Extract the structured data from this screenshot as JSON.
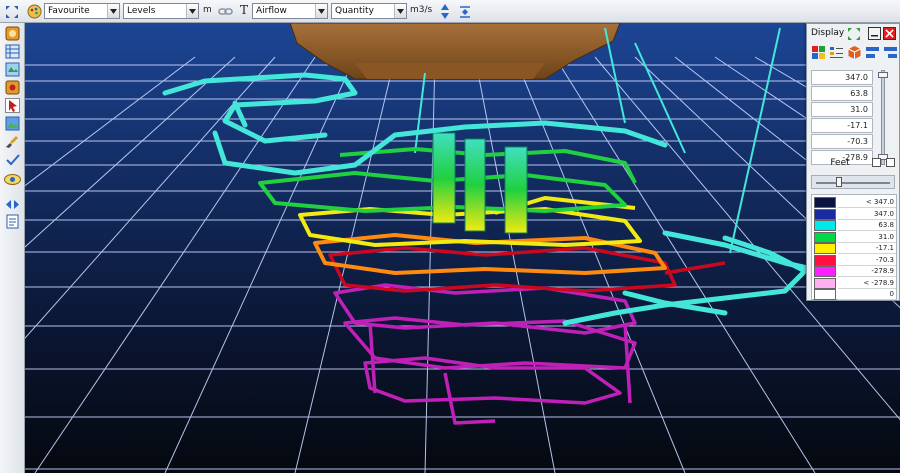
{
  "toolbar": {
    "favourite_label": "Favourite",
    "levels_label": "Levels",
    "levels_unit": "m",
    "text_tool_glyph": "T",
    "attribute_label": "Airflow",
    "measure_label": "Quantity",
    "unit_label": "m3/s"
  },
  "panel": {
    "title": "Display",
    "values": [
      "347.0",
      "63.8",
      "31.0",
      "-17.1",
      "-70.3",
      "-278.9"
    ],
    "mode_label": "Feet"
  },
  "legend": [
    {
      "color": "#0a1440",
      "label": "< 347.0"
    },
    {
      "color": "#1a2aa0",
      "label": "347.0"
    },
    {
      "color": "#00e8e8",
      "label": "63.8"
    },
    {
      "color": "#00d84a",
      "label": "31.0"
    },
    {
      "color": "#ffee00",
      "label": "-17.1"
    },
    {
      "color": "#ff1040",
      "label": "-70.3"
    },
    {
      "color": "#ff20ff",
      "label": "-278.9"
    },
    {
      "color": "#ffb0f0",
      "label": "< -278.9"
    },
    {
      "color": "#ffffff",
      "label": "0"
    }
  ],
  "colors": {
    "cyan": "#45e6da",
    "green": "#20d040",
    "yellow": "#f2ea10",
    "orange": "#ff8a10",
    "red": "#cc0820",
    "magenta": "#c020b8",
    "grid": "#c8d6ff"
  },
  "icons": {
    "left": [
      "module-icon",
      "table-icon",
      "map-icon",
      "module-icon",
      "pointer-icon",
      "image-icon",
      "brush-icon",
      "check-tool-icon",
      "orbit-icon",
      "nav-arrows-icon",
      "page-icon"
    ]
  }
}
